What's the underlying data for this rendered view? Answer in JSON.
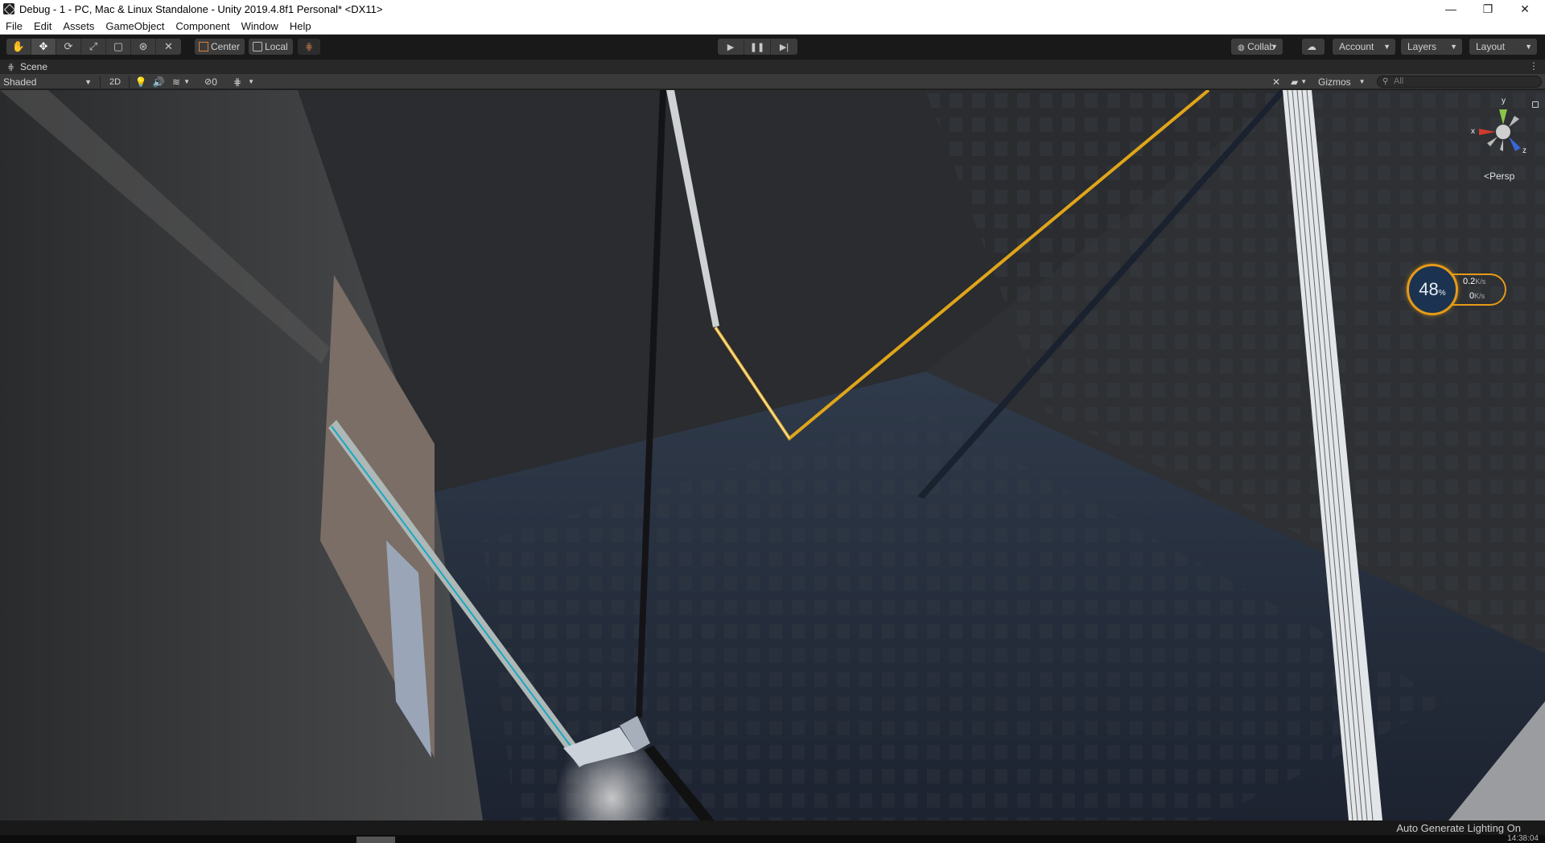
{
  "window": {
    "title": "Debug - 1 - PC, Mac & Linux Standalone - Unity 2019.4.8f1 Personal* <DX11>",
    "controls": {
      "minimize": "—",
      "maximize": "❐",
      "close": "✕"
    }
  },
  "menu": [
    "File",
    "Edit",
    "Assets",
    "GameObject",
    "Component",
    "Window",
    "Help"
  ],
  "toolbar": {
    "tools": [
      {
        "name": "hand-tool",
        "glyph": "✋"
      },
      {
        "name": "move-tool",
        "glyph": "✥"
      },
      {
        "name": "rotate-tool",
        "glyph": "⟳"
      },
      {
        "name": "scale-tool",
        "glyph": "⤢"
      },
      {
        "name": "rect-tool",
        "glyph": "▢"
      },
      {
        "name": "transform-tool",
        "glyph": "⊛"
      },
      {
        "name": "custom-tool",
        "glyph": "✕"
      }
    ],
    "pivot_label": "Center",
    "rotation_label": "Local",
    "play_glyph": "▶",
    "pause_glyph": "❚❚",
    "step_glyph": "▶|",
    "collab_label": "Collab",
    "account_label": "Account",
    "layers_label": "Layers",
    "layout_label": "Layout"
  },
  "scene_tab": {
    "label": "Scene"
  },
  "scene_bar": {
    "shading_mode": "Shaded",
    "mode_2d": "2D",
    "hidden_count": "0",
    "gizmos_label": "Gizmos",
    "search_placeholder": "All"
  },
  "gizmo": {
    "x": "x",
    "y": "y",
    "z": "z",
    "projection": "<Persp"
  },
  "net_monitor": {
    "percent": "48",
    "percent_unit": "%",
    "upload": "0.2",
    "download": "0",
    "rate_unit": "K/s"
  },
  "status": {
    "text": "Auto Generate Lighting On",
    "clock": "14:38:04"
  },
  "colors": {
    "selection_line": "#e0a51a",
    "net_accent": "#e69a18"
  }
}
